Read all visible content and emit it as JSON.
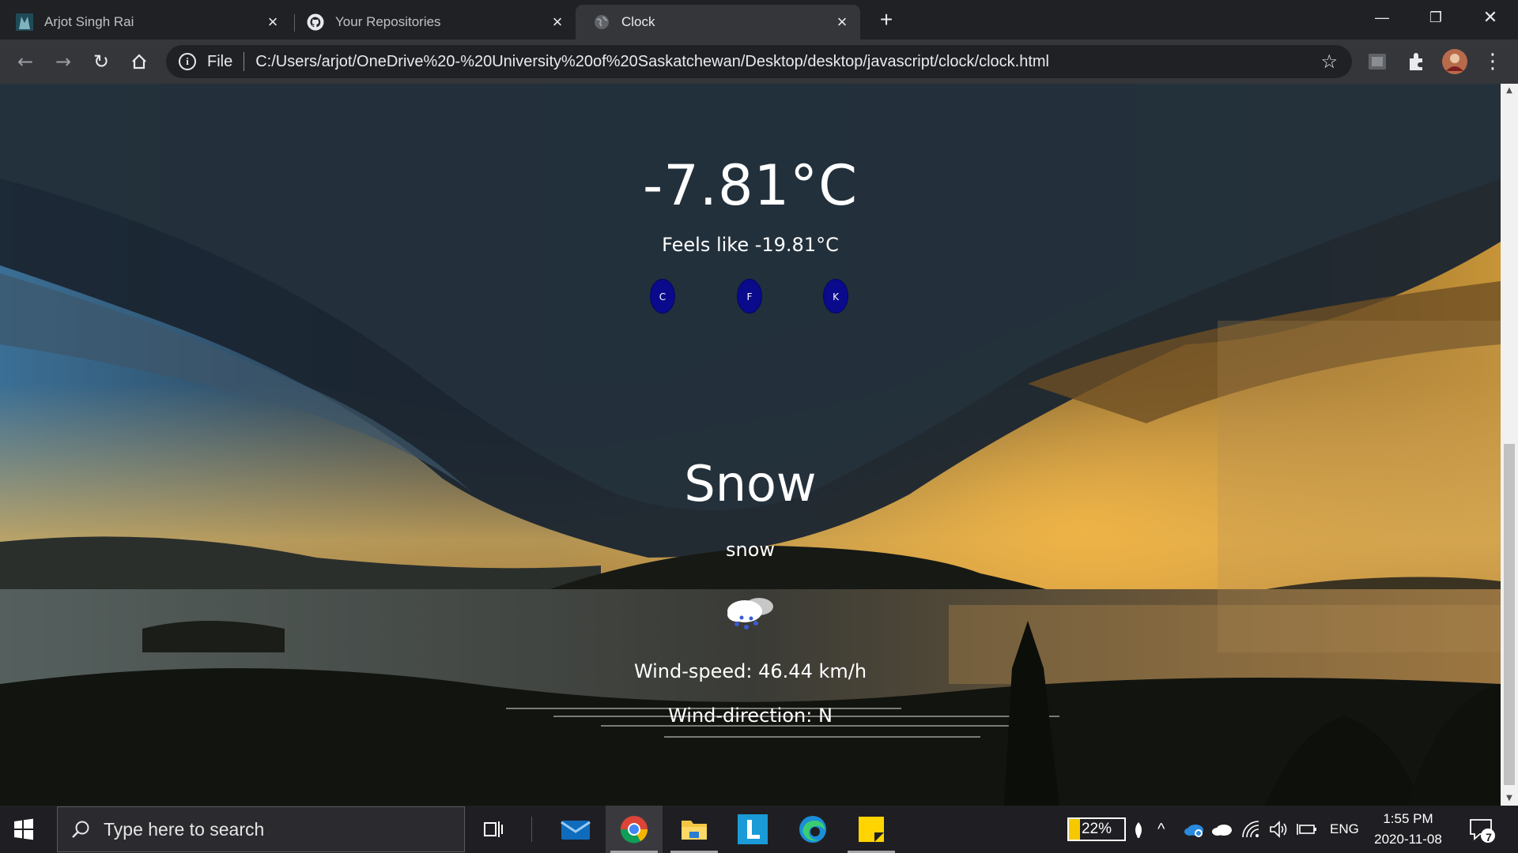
{
  "browser": {
    "tabs": [
      {
        "title": "Arjot Singh Rai",
        "icon": "profile-favicon"
      },
      {
        "title": "Your Repositories",
        "icon": "github-icon"
      },
      {
        "title": "Clock",
        "icon": "globe-icon",
        "active": true
      }
    ],
    "address": {
      "scheme_label": "File",
      "url": "C:/Users/arjot/OneDrive%20-%20University%20of%20Saskatchewan/Desktop/desktop/javascript/clock/clock.html"
    }
  },
  "weather": {
    "temperature": "-7.81°C",
    "feels_like": "Feels like -19.81°C",
    "units": [
      "C",
      "F",
      "K"
    ],
    "condition": "Snow",
    "description": "snow",
    "icon": "snow-cloud-icon",
    "wind_speed": "Wind-speed: 46.44 km/h",
    "wind_direction": "Wind-direction: N"
  },
  "taskbar": {
    "search_placeholder": "Type here to search",
    "apps": [
      "task-view",
      "mail",
      "chrome",
      "file-explorer",
      "l-app",
      "edge",
      "sticky-notes"
    ],
    "battery": "22%",
    "language": "ENG",
    "time": "1:55 PM",
    "date": "2020-11-08",
    "notification_count": "7"
  },
  "colors": {
    "unit_button": "#0a0a8c",
    "chrome_bg": "#202124",
    "toolbar_bg": "#35363a",
    "taskbar_bg": "#1f1f23"
  }
}
